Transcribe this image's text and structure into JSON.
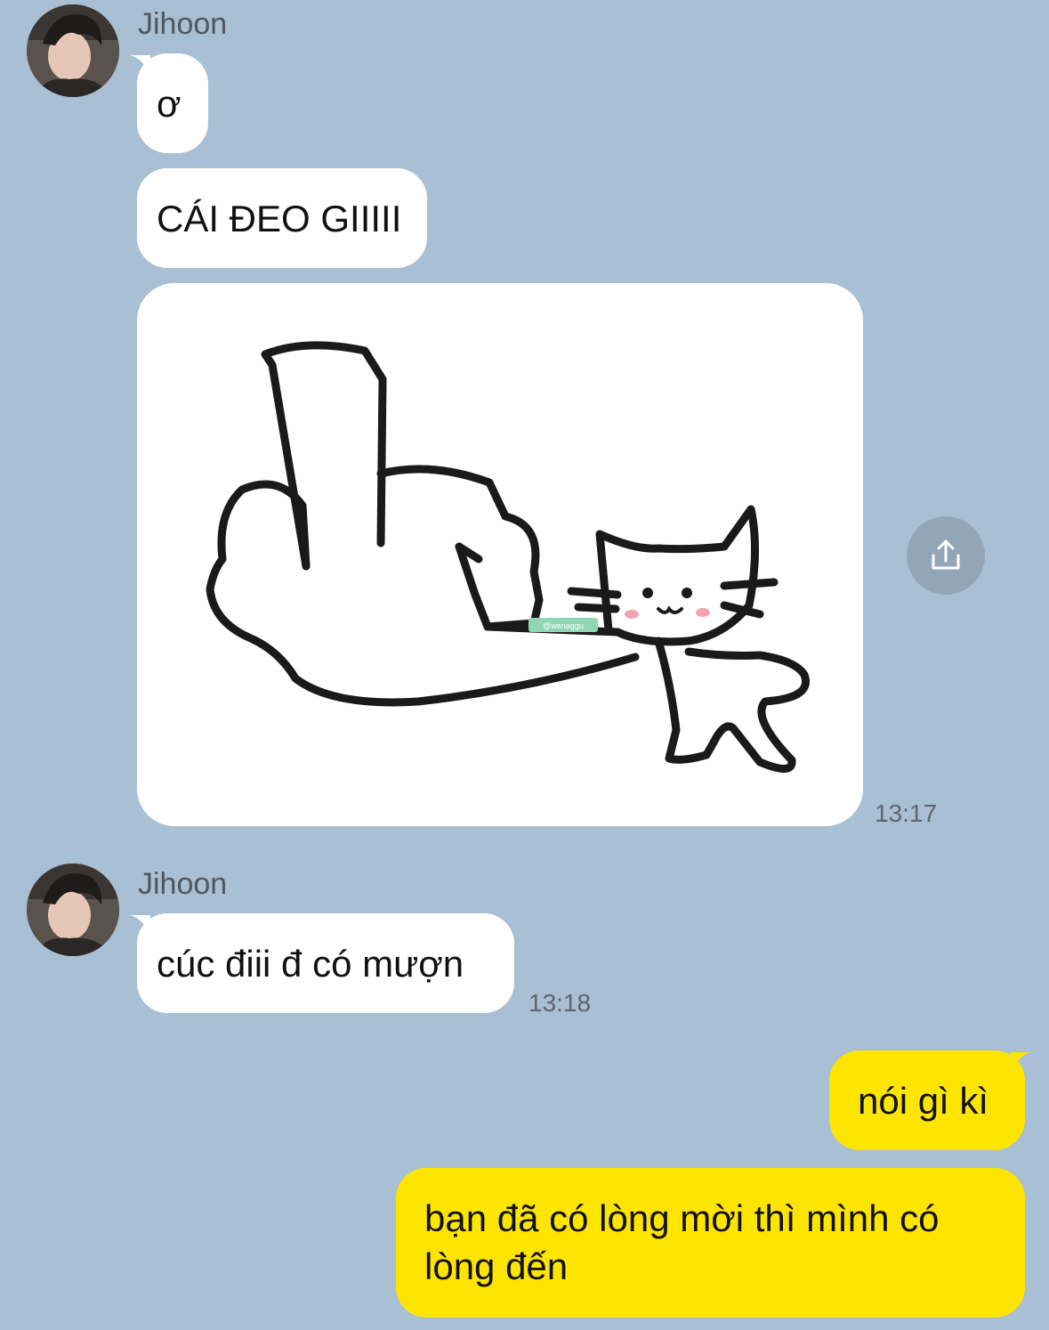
{
  "chat": {
    "group1": {
      "sender": "Jihoon",
      "msg1": "ơ",
      "msg2": "CÁI ĐEO GIIIII",
      "image_watermark": "@wenaggu",
      "time": "13:17"
    },
    "group2": {
      "sender": "Jihoon",
      "msg1": "cúc điii đ có mượn",
      "time": "13:18"
    },
    "outgoing": {
      "msg1": "nói gì kì",
      "msg2": "bạn đã có lòng mời thì mình có lòng đến"
    }
  },
  "icons": {
    "share": "share-icon",
    "avatar": "avatar-photo"
  },
  "colors": {
    "background": "#a9bfd3",
    "incoming_bubble": "#ffffff",
    "outgoing_bubble": "#fee500",
    "share_button": "#93a6b8"
  }
}
